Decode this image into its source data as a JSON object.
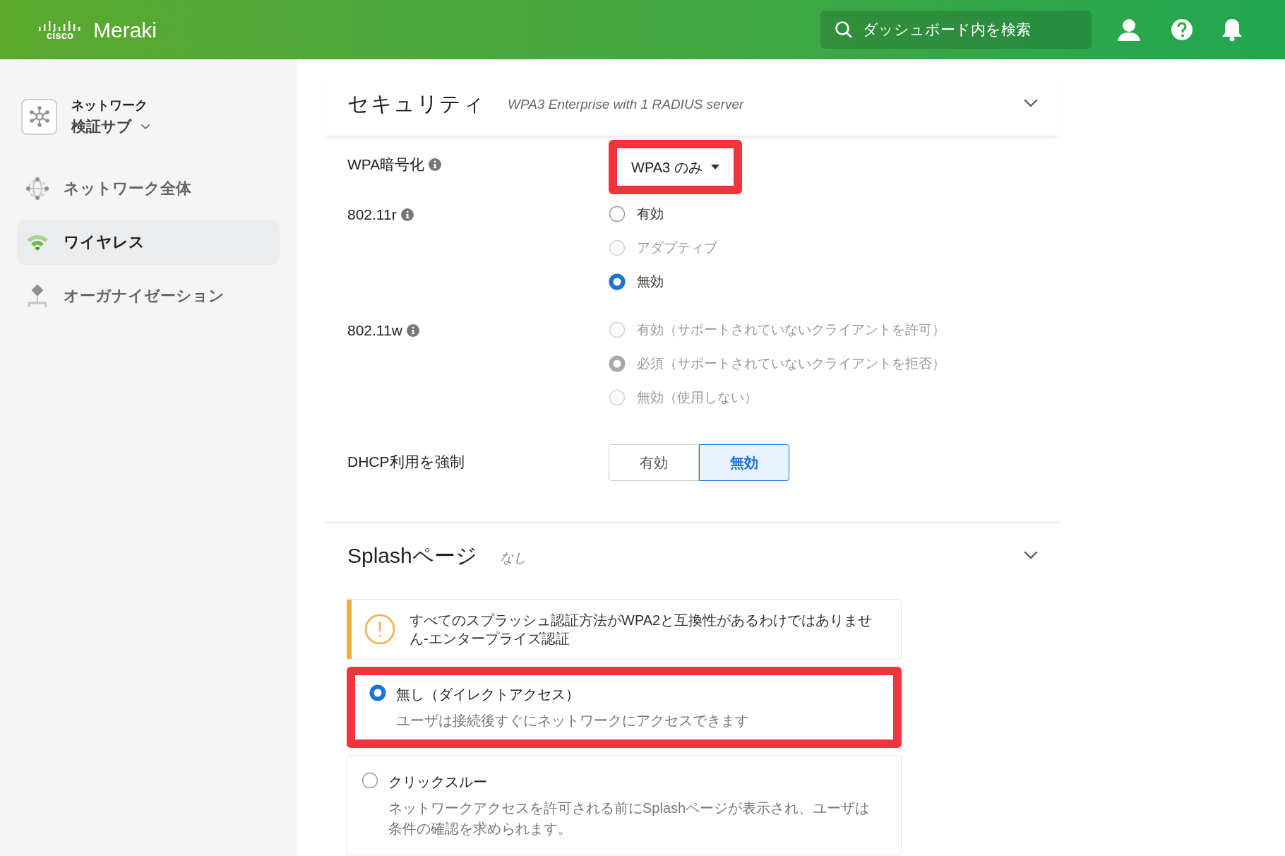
{
  "header": {
    "logo_mark": "cisco",
    "logo_text": "Meraki",
    "search": {
      "placeholder": "ダッシュボード内を検索"
    }
  },
  "sidebar": {
    "network": {
      "line1": "ネットワーク",
      "line2": "検証サブ"
    },
    "items": [
      {
        "kind": "globe",
        "label": "ネットワーク全体",
        "selected": false
      },
      {
        "kind": "wifi",
        "label": "ワイヤレス",
        "selected": true
      },
      {
        "kind": "org",
        "label": "オーガナイゼーション",
        "selected": false
      }
    ]
  },
  "security": {
    "title": "セキュリティ",
    "summary": "WPA3 Enterprise with 1 RADIUS server",
    "rows": [
      {
        "kind": "dropdown",
        "label": "WPA暗号化",
        "info": true,
        "value": "WPA3 のみ",
        "highlighted": true
      },
      {
        "kind": "radio",
        "label": "802.11r",
        "info": true,
        "options": [
          {
            "label": "有効",
            "selected": false,
            "disabled": false
          },
          {
            "label": "アダプティブ",
            "selected": false,
            "disabled": true
          },
          {
            "label": "無効",
            "selected": true,
            "disabled": false
          }
        ]
      },
      {
        "kind": "radio",
        "label": "802.11w",
        "info": true,
        "options": [
          {
            "label": "有効（サポートされていないクライアントを許可）",
            "selected": false,
            "disabled": true
          },
          {
            "label": "必須（サポートされていないクライアントを拒否）",
            "selected": true,
            "disabled": true
          },
          {
            "label": "無効（使用しない）",
            "selected": false,
            "disabled": true
          }
        ]
      },
      {
        "kind": "toggle",
        "label": "DHCP利用を強制",
        "info": false,
        "options": [
          {
            "label": "有効",
            "selected": false
          },
          {
            "label": "無効",
            "selected": true
          }
        ]
      }
    ]
  },
  "splash": {
    "title": "Splashページ",
    "summary": "なし",
    "warning": "すべてのスプラッシュ認証方法がWPA2と互換性があるわけではありません-エンタープライズ認証",
    "options": [
      {
        "label": "無し（ダイレクトアクセス）",
        "description": "ユーザは接続後すぐにネットワークにアクセスできます",
        "selected": true,
        "highlighted": true
      },
      {
        "label": "クリックスルー",
        "description": "ネットワークアクセスを許可される前にSplashページが表示され、ユーザは条件の確認を求められます。",
        "selected": false,
        "highlighted": false
      }
    ]
  }
}
